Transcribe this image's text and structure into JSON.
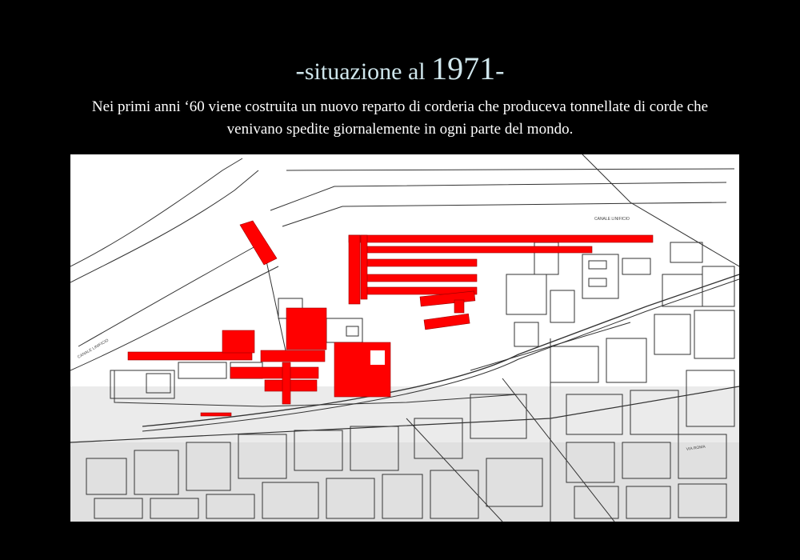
{
  "slide": {
    "title": {
      "dash_left": "-",
      "word": "situazione al ",
      "year": "1971",
      "dash_right": "-"
    },
    "description": {
      "line1": "Nei primi anni ʻ60 viene costruita  un nuovo reparto di corderia che produceva tonnellate di corde che",
      "line2": "venivano spedite giornalemente  in ogni parte del mondo."
    }
  },
  "map": {
    "highlight_color": "#ff0000",
    "line_color": "#333333",
    "background_color": "#ffffff",
    "labels": {
      "canal_right": "CANALE  LINIFICIO",
      "canal_left": "CANALE  LINIFICIO",
      "street": "VIA ROMA"
    }
  }
}
